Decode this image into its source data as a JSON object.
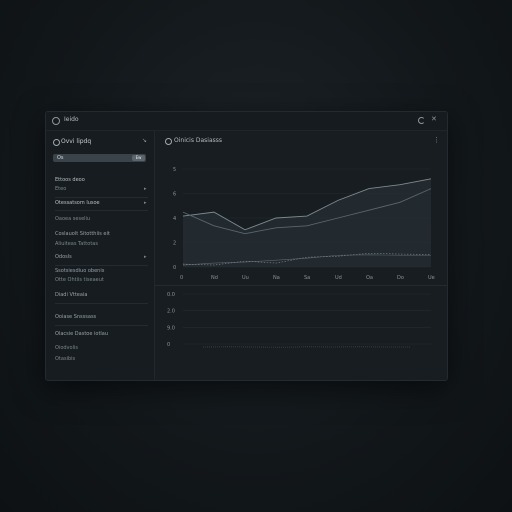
{
  "window": {
    "title": "Ieido"
  },
  "sidebar": {
    "title": "Ovvi lipdq",
    "search": {
      "value": "Os",
      "button": "Ew"
    },
    "items": [
      {
        "label": "Ettoos deoo",
        "sub": false
      },
      {
        "label": "Eteo",
        "sub": true
      },
      {
        "label": "Otessatsom lusoe",
        "sub": false
      },
      {
        "label": "Oaoea seseliu",
        "sub": true
      },
      {
        "label": "Coslauolt Sitotthiis eit",
        "sub": false
      },
      {
        "label": "Aliuiteas Tattotas",
        "sub": true
      },
      {
        "label": "Odosls",
        "sub": false
      },
      {
        "label": "Ssotsiesdiuo obenis",
        "sub": false
      },
      {
        "label": "Otte Ohtiis tiseaeut",
        "sub": true
      },
      {
        "label": "Diadi Vtteaia",
        "sub": false
      },
      {
        "label": "Ooiase Snsssass",
        "sub": false
      },
      {
        "label": "Olacsie Dastoe iotlau",
        "sub": false
      },
      {
        "label": "Oiodvolis",
        "sub": true
      },
      {
        "label": "Otasibis",
        "sub": true
      }
    ]
  },
  "panel": {
    "title": "Oinicis Dasiasss"
  },
  "colors": {
    "line_primary": "#7e8a90",
    "line_secondary": "#5b666c",
    "area": "#262e33",
    "grid": "#242c31"
  },
  "chart_data": [
    {
      "type": "line",
      "x": [
        "0",
        "Nd",
        "Uu",
        "Na",
        "Sa",
        "Ud",
        "Oa",
        "Do",
        "Ue"
      ],
      "ylabels": [
        "5",
        "6",
        "4",
        "2",
        "0"
      ],
      "series": [
        {
          "values": [
            2.6,
            2.8,
            1.9,
            2.5,
            2.6,
            3.4,
            4.0,
            4.2,
            4.5
          ]
        },
        {
          "values": [
            2.8,
            2.1,
            1.7,
            2.0,
            2.1,
            2.5,
            2.9,
            3.3,
            4.0
          ]
        },
        {
          "values": [
            0.1,
            0.2,
            0.25,
            0.35,
            0.45,
            0.6,
            0.62,
            0.6,
            0.58
          ]
        },
        {
          "values": [
            0.15,
            0.1,
            0.3,
            0.2,
            0.5,
            0.55,
            0.7,
            0.66,
            0.64
          ]
        }
      ],
      "ylim": [
        0,
        5
      ],
      "grid": true
    },
    {
      "type": "line",
      "ylabels": [
        "0.0",
        "2.0",
        "9.0",
        "0"
      ],
      "series": [
        {
          "values": [
            0.05,
            0.06,
            0.05,
            0.04,
            0.06,
            0.05,
            0.06,
            0.05,
            0.05
          ]
        }
      ],
      "ylim": [
        0,
        3
      ],
      "grid": true
    }
  ]
}
